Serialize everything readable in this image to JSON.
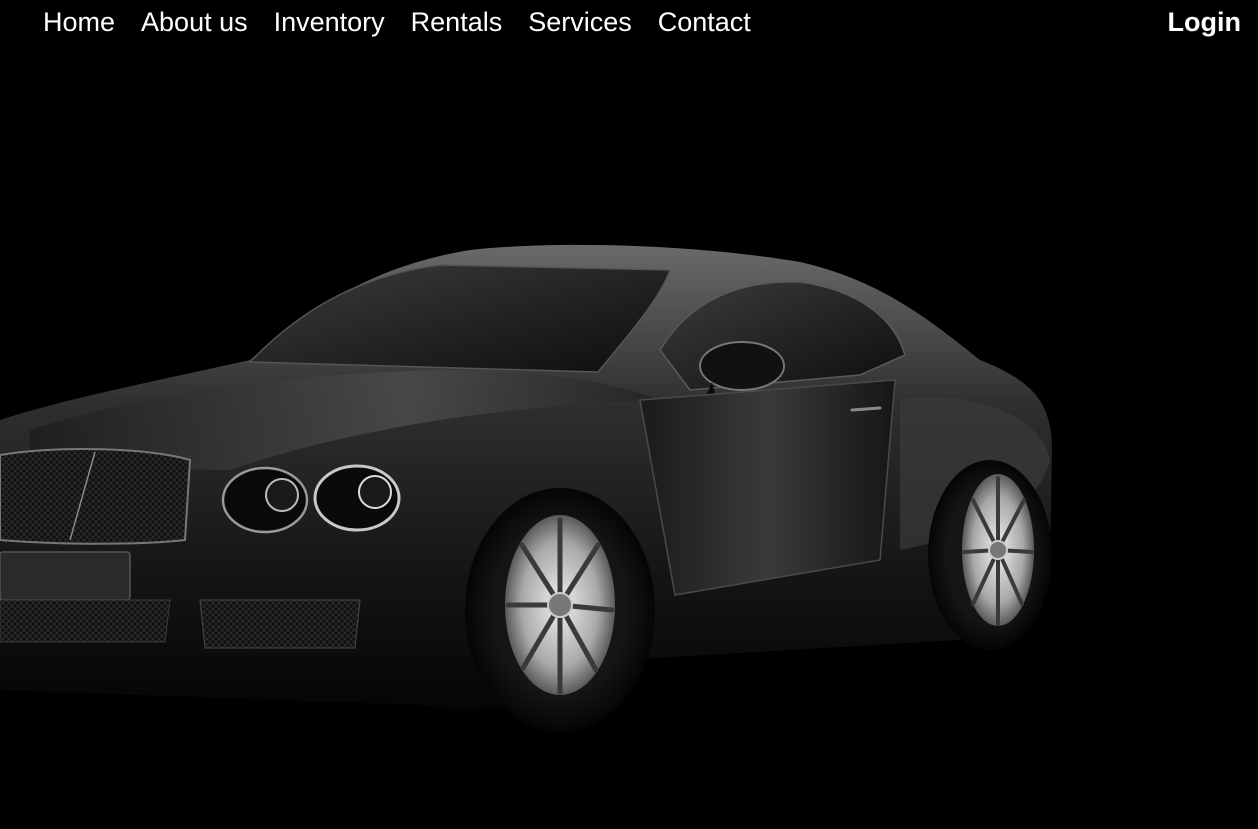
{
  "nav": {
    "items": [
      {
        "label": "Home"
      },
      {
        "label": "About us"
      },
      {
        "label": "Inventory"
      },
      {
        "label": "Rentals"
      },
      {
        "label": "Services"
      },
      {
        "label": "Contact"
      }
    ],
    "login_label": "Login"
  },
  "colors": {
    "background": "#000000",
    "nav_text": "#ffffff"
  },
  "hero": {
    "image": "car-hero-image"
  }
}
